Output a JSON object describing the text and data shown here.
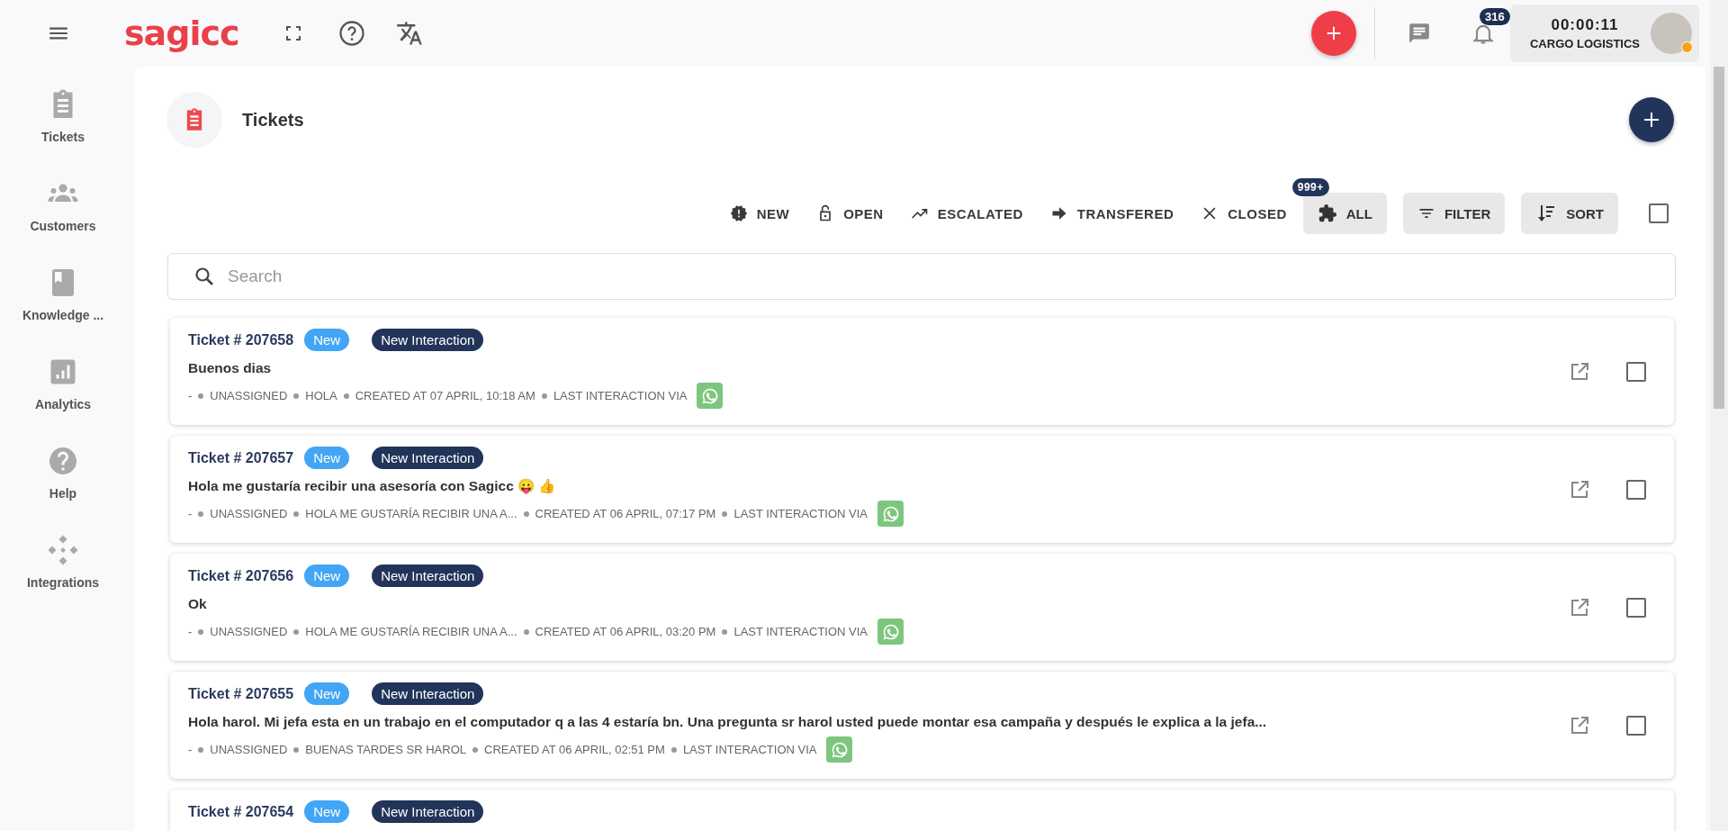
{
  "topbar": {
    "logo": "sagicc",
    "notification_count": "316",
    "timer": "00:00:11",
    "company": "CARGO LOGISTICS"
  },
  "sidebar": {
    "items": [
      {
        "label": "Tickets",
        "kind": "clipboard"
      },
      {
        "label": "Customers",
        "kind": "people"
      },
      {
        "label": "Knowledge ...",
        "kind": "book"
      },
      {
        "label": "Analytics",
        "kind": "chart"
      },
      {
        "label": "Help",
        "kind": "help"
      },
      {
        "label": "Integrations",
        "kind": "diamonds"
      }
    ]
  },
  "page": {
    "title": "Tickets"
  },
  "filters": [
    {
      "label": "NEW",
      "kind": "alert"
    },
    {
      "label": "OPEN",
      "kind": "lock"
    },
    {
      "label": "ESCALATED",
      "kind": "trend"
    },
    {
      "label": "TRANSFERED",
      "kind": "arrow"
    },
    {
      "label": "CLOSED",
      "kind": "close"
    }
  ],
  "all_button": {
    "label": "ALL",
    "badge": "999+"
  },
  "filter_button": {
    "label": "FILTER"
  },
  "sort_button": {
    "label": "SORT"
  },
  "select_all": {
    "checked": false
  },
  "search": {
    "placeholder": "Search"
  },
  "tickets": [
    {
      "number": "Ticket # 207658",
      "status": "New",
      "tag": "New Interaction",
      "subject": "Buenos dias",
      "meta": [
        "-",
        "UNASSIGNED",
        "HOLA",
        "CREATED AT 07 APRIL, 10:18 AM",
        "LAST INTERACTION VIA"
      ],
      "channel": {
        "kind": "whatsapp"
      },
      "checked": false
    },
    {
      "number": "Ticket # 207657",
      "status": "New",
      "tag": "New Interaction",
      "subject": "Hola me gustaría recibir una asesoría con Sagicc 😛 👍",
      "meta": [
        "-",
        "UNASSIGNED",
        "HOLA ME GUSTARÍA RECIBIR UNA A...",
        "CREATED AT 06 APRIL, 07:17 PM",
        "LAST INTERACTION VIA"
      ],
      "channel": {
        "kind": "whatsapp"
      },
      "checked": false
    },
    {
      "number": "Ticket # 207656",
      "status": "New",
      "tag": "New Interaction",
      "subject": "Ok",
      "meta": [
        "-",
        "UNASSIGNED",
        "HOLA ME GUSTARÍA RECIBIR UNA A...",
        "CREATED AT 06 APRIL, 03:20 PM",
        "LAST INTERACTION VIA"
      ],
      "channel": {
        "kind": "whatsapp"
      },
      "checked": false
    },
    {
      "number": "Ticket # 207655",
      "status": "New",
      "tag": "New Interaction",
      "subject": "Hola harol. Mi jefa esta en un trabajo en el computador q a las 4 estaría bn. Una pregunta sr harol usted puede montar esa campaña y después le explica a la jefa...",
      "meta": [
        "-",
        "UNASSIGNED",
        "BUENAS TARDES SR HAROL",
        "CREATED AT 06 APRIL, 02:51 PM",
        "LAST INTERACTION VIA"
      ],
      "channel": {
        "kind": "whatsapp"
      },
      "checked": false
    },
    {
      "number": "Ticket # 207654",
      "status": "New",
      "tag": "New Interaction"
    }
  ]
}
